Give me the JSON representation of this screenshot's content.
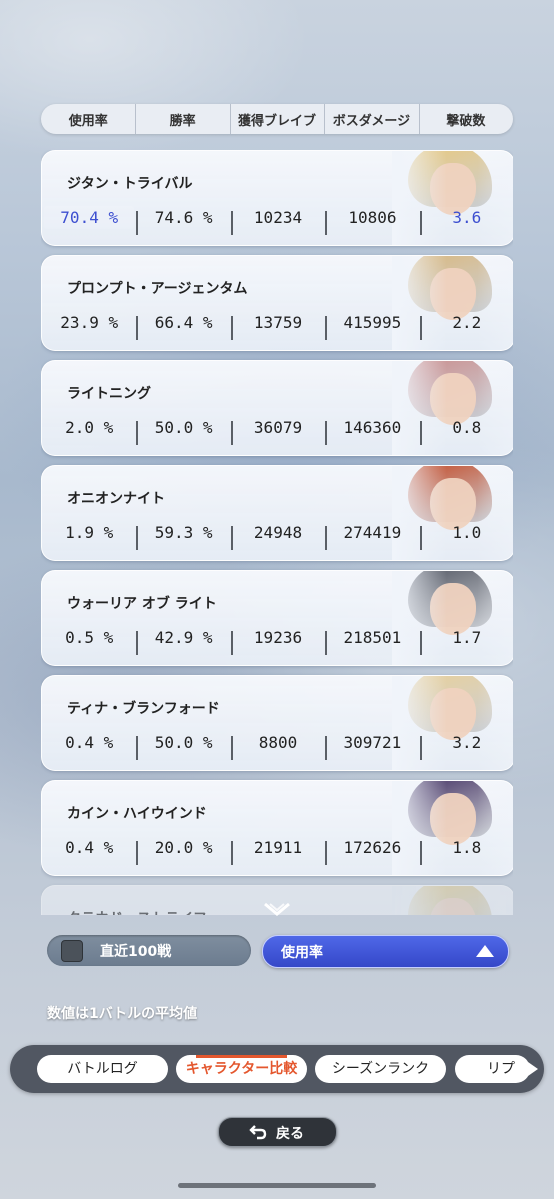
{
  "header": {
    "columns": [
      "使用率",
      "勝率",
      "獲得ブレイブ",
      "ボスダメージ",
      "撃破数"
    ]
  },
  "characters": [
    {
      "name": "ジタン・トライバル",
      "stats": [
        "70.4 %",
        "74.6 %",
        "10234",
        "10806",
        "3.6"
      ],
      "hair": "#e8c77a",
      "highlight": true
    },
    {
      "name": "プロンプト・アージェンタム",
      "stats": [
        "23.9 %",
        "66.4 %",
        "13759",
        "415995",
        "2.2"
      ],
      "hair": "#d9b67a"
    },
    {
      "name": "ライトニング",
      "stats": [
        "2.0 %",
        "50.0 %",
        "36079",
        "146360",
        "0.8"
      ],
      "hair": "#c98a8a"
    },
    {
      "name": "オニオンナイト",
      "stats": [
        "1.9 %",
        "59.3 %",
        "24948",
        "274419",
        "1.0"
      ],
      "hair": "#c2431f"
    },
    {
      "name": "ウォーリア オブ ライト",
      "stats": [
        "0.5 %",
        "42.9 %",
        "19236",
        "218501",
        "1.7"
      ],
      "hair": "#4a4f5c"
    },
    {
      "name": "ティナ・ブランフォード",
      "stats": [
        "0.4 %",
        "50.0 %",
        "8800",
        "309721",
        "3.2"
      ],
      "hair": "#e9cf97"
    },
    {
      "name": "カイン・ハイウインド",
      "stats": [
        "0.4 %",
        "20.0 %",
        "21911",
        "172626",
        "1.8"
      ],
      "hair": "#3c2a5e"
    },
    {
      "name": "クラウド・ストライフ",
      "stats": [
        "",
        "",
        "",
        "",
        ""
      ],
      "hair": "#e6cc84",
      "faded": true
    }
  ],
  "filter": {
    "label": "直近100戦",
    "checked": false
  },
  "sort": {
    "label": "使用率",
    "direction": "ascending"
  },
  "note": "数値は1バトルの平均値",
  "tabs": [
    {
      "label": "バトルログ",
      "active": false
    },
    {
      "label": "キャラクター比較",
      "active": true
    },
    {
      "label": "シーズンランク",
      "active": false
    },
    {
      "label": "リプ",
      "active": false
    }
  ],
  "back_button": {
    "label": "戻る"
  },
  "colors": {
    "highlight": "#3d4fd0",
    "accent_tab": "#e4572e",
    "sort_bg": "#3547c8"
  }
}
